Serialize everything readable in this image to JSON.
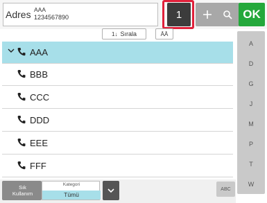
{
  "topbar": {
    "address_label": "Adres",
    "address_name": "AAA",
    "address_number": "1234567890",
    "count": "1",
    "ok_label": "OK"
  },
  "sortbar": {
    "sort_label": "Sırala",
    "sort_icon_text": "1↓",
    "az_text": "ĀĀ"
  },
  "list": {
    "items": [
      {
        "label": "AAA"
      },
      {
        "label": "BBB"
      },
      {
        "label": "CCC"
      },
      {
        "label": "DDD"
      },
      {
        "label": "EEE"
      },
      {
        "label": "FFF"
      }
    ],
    "selected_index": 0
  },
  "index": {
    "letters": [
      "A",
      "D",
      "G",
      "J",
      "M",
      "P",
      "T",
      "W"
    ]
  },
  "bottombar": {
    "freq_label_1": "Sık",
    "freq_label_2": "Kullanım",
    "category_label": "Kategori",
    "category_value": "Tümü",
    "abc_label": "ABC"
  },
  "colors": {
    "ok_green": "#24a83b",
    "highlight_red": "#e0203a",
    "selection_cyan": "#a7dfe9"
  }
}
